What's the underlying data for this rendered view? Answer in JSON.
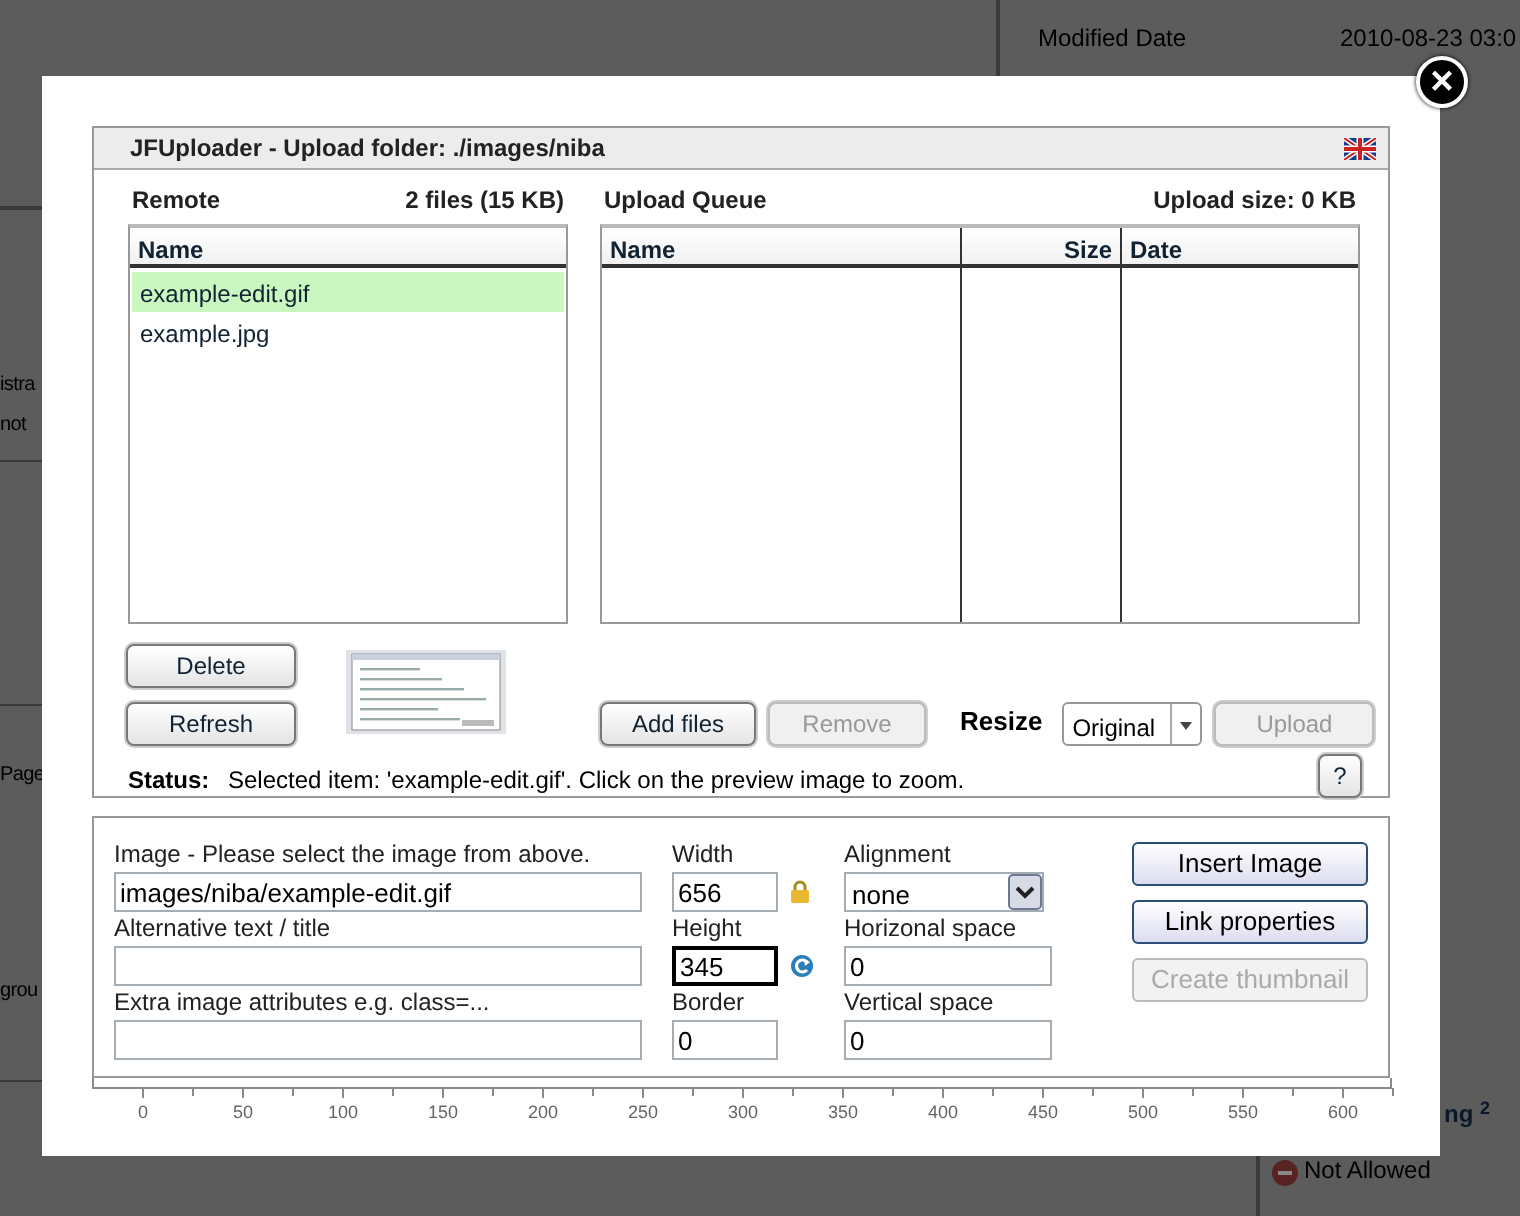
{
  "background": {
    "texts": [
      {
        "text": "Modified Date",
        "kind": "label"
      },
      {
        "text": "2010-08-23 03:0",
        "kind": "value"
      },
      {
        "text": "istra",
        "kind": "fragment"
      },
      {
        "text": "not",
        "kind": "fragment"
      },
      {
        "text": "Page",
        "kind": "fragment"
      },
      {
        "text": "grou",
        "kind": "fragment"
      },
      {
        "text": "ng $^{2}$",
        "kind": "heading"
      },
      {
        "text": "Not Allowed",
        "kind": "status"
      }
    ]
  },
  "dialog": {
    "close": "×"
  },
  "uploader": {
    "title": "JFUploader - Upload folder: ./images/niba",
    "remote": {
      "label": "Remote",
      "summary": "2 files (15 KB)",
      "column": "Name",
      "files": [
        {
          "name": "example-edit.gif",
          "selected": true
        },
        {
          "name": "example.jpg",
          "selected": false
        }
      ]
    },
    "queue": {
      "label": "Upload Queue",
      "summary": "Upload size: 0 KB",
      "columns": [
        "Name",
        "Size",
        "Date"
      ]
    },
    "remote_buttons": [
      {
        "label": "Delete",
        "disabled": false
      },
      {
        "label": "Refresh",
        "disabled": false
      }
    ],
    "queue_buttons": [
      {
        "label": "Add files",
        "disabled": false
      },
      {
        "label": "Remove",
        "disabled": true
      }
    ],
    "resize": {
      "label": "Resize",
      "value": "Original"
    },
    "upload_button": {
      "label": "Upload",
      "disabled": true
    },
    "status": {
      "label": "Status:",
      "text": "Selected item: 'example-edit.gif'. Click on the preview image to zoom."
    },
    "help": "?"
  },
  "image_form": {
    "fields": [
      {
        "label": "Image - Please select the image from above.",
        "value": "images/niba/example-edit.gif",
        "focused": false
      },
      {
        "label": "Alternative text / title",
        "focused": false
      },
      {
        "label": "Extra image attributes e.g. class=...",
        "focused": false
      }
    ],
    "size_fields": [
      {
        "label": "Width",
        "value": "656",
        "focused": false,
        "kind": "lock"
      },
      {
        "label": "Height",
        "value": "345",
        "focused": true,
        "kind": "reset"
      },
      {
        "label": "Border",
        "value": "0",
        "focused": false,
        "kind": "plain"
      }
    ],
    "alignment": {
      "label": "Alignment",
      "value": "none"
    },
    "space_fields": [
      {
        "label": "Horizonal space",
        "value": "0",
        "focused": false
      },
      {
        "label": "Vertical space",
        "value": "0",
        "focused": false
      }
    ],
    "buttons": [
      {
        "label": "Insert Image",
        "disabled": false
      },
      {
        "label": "Link properties",
        "disabled": false
      },
      {
        "label": "Create thumbnail",
        "disabled": true
      }
    ]
  },
  "ruler": {
    "labels": [
      "0",
      "50",
      "100",
      "150",
      "200",
      "250",
      "300",
      "350",
      "400",
      "450",
      "500",
      "550",
      "600"
    ]
  }
}
